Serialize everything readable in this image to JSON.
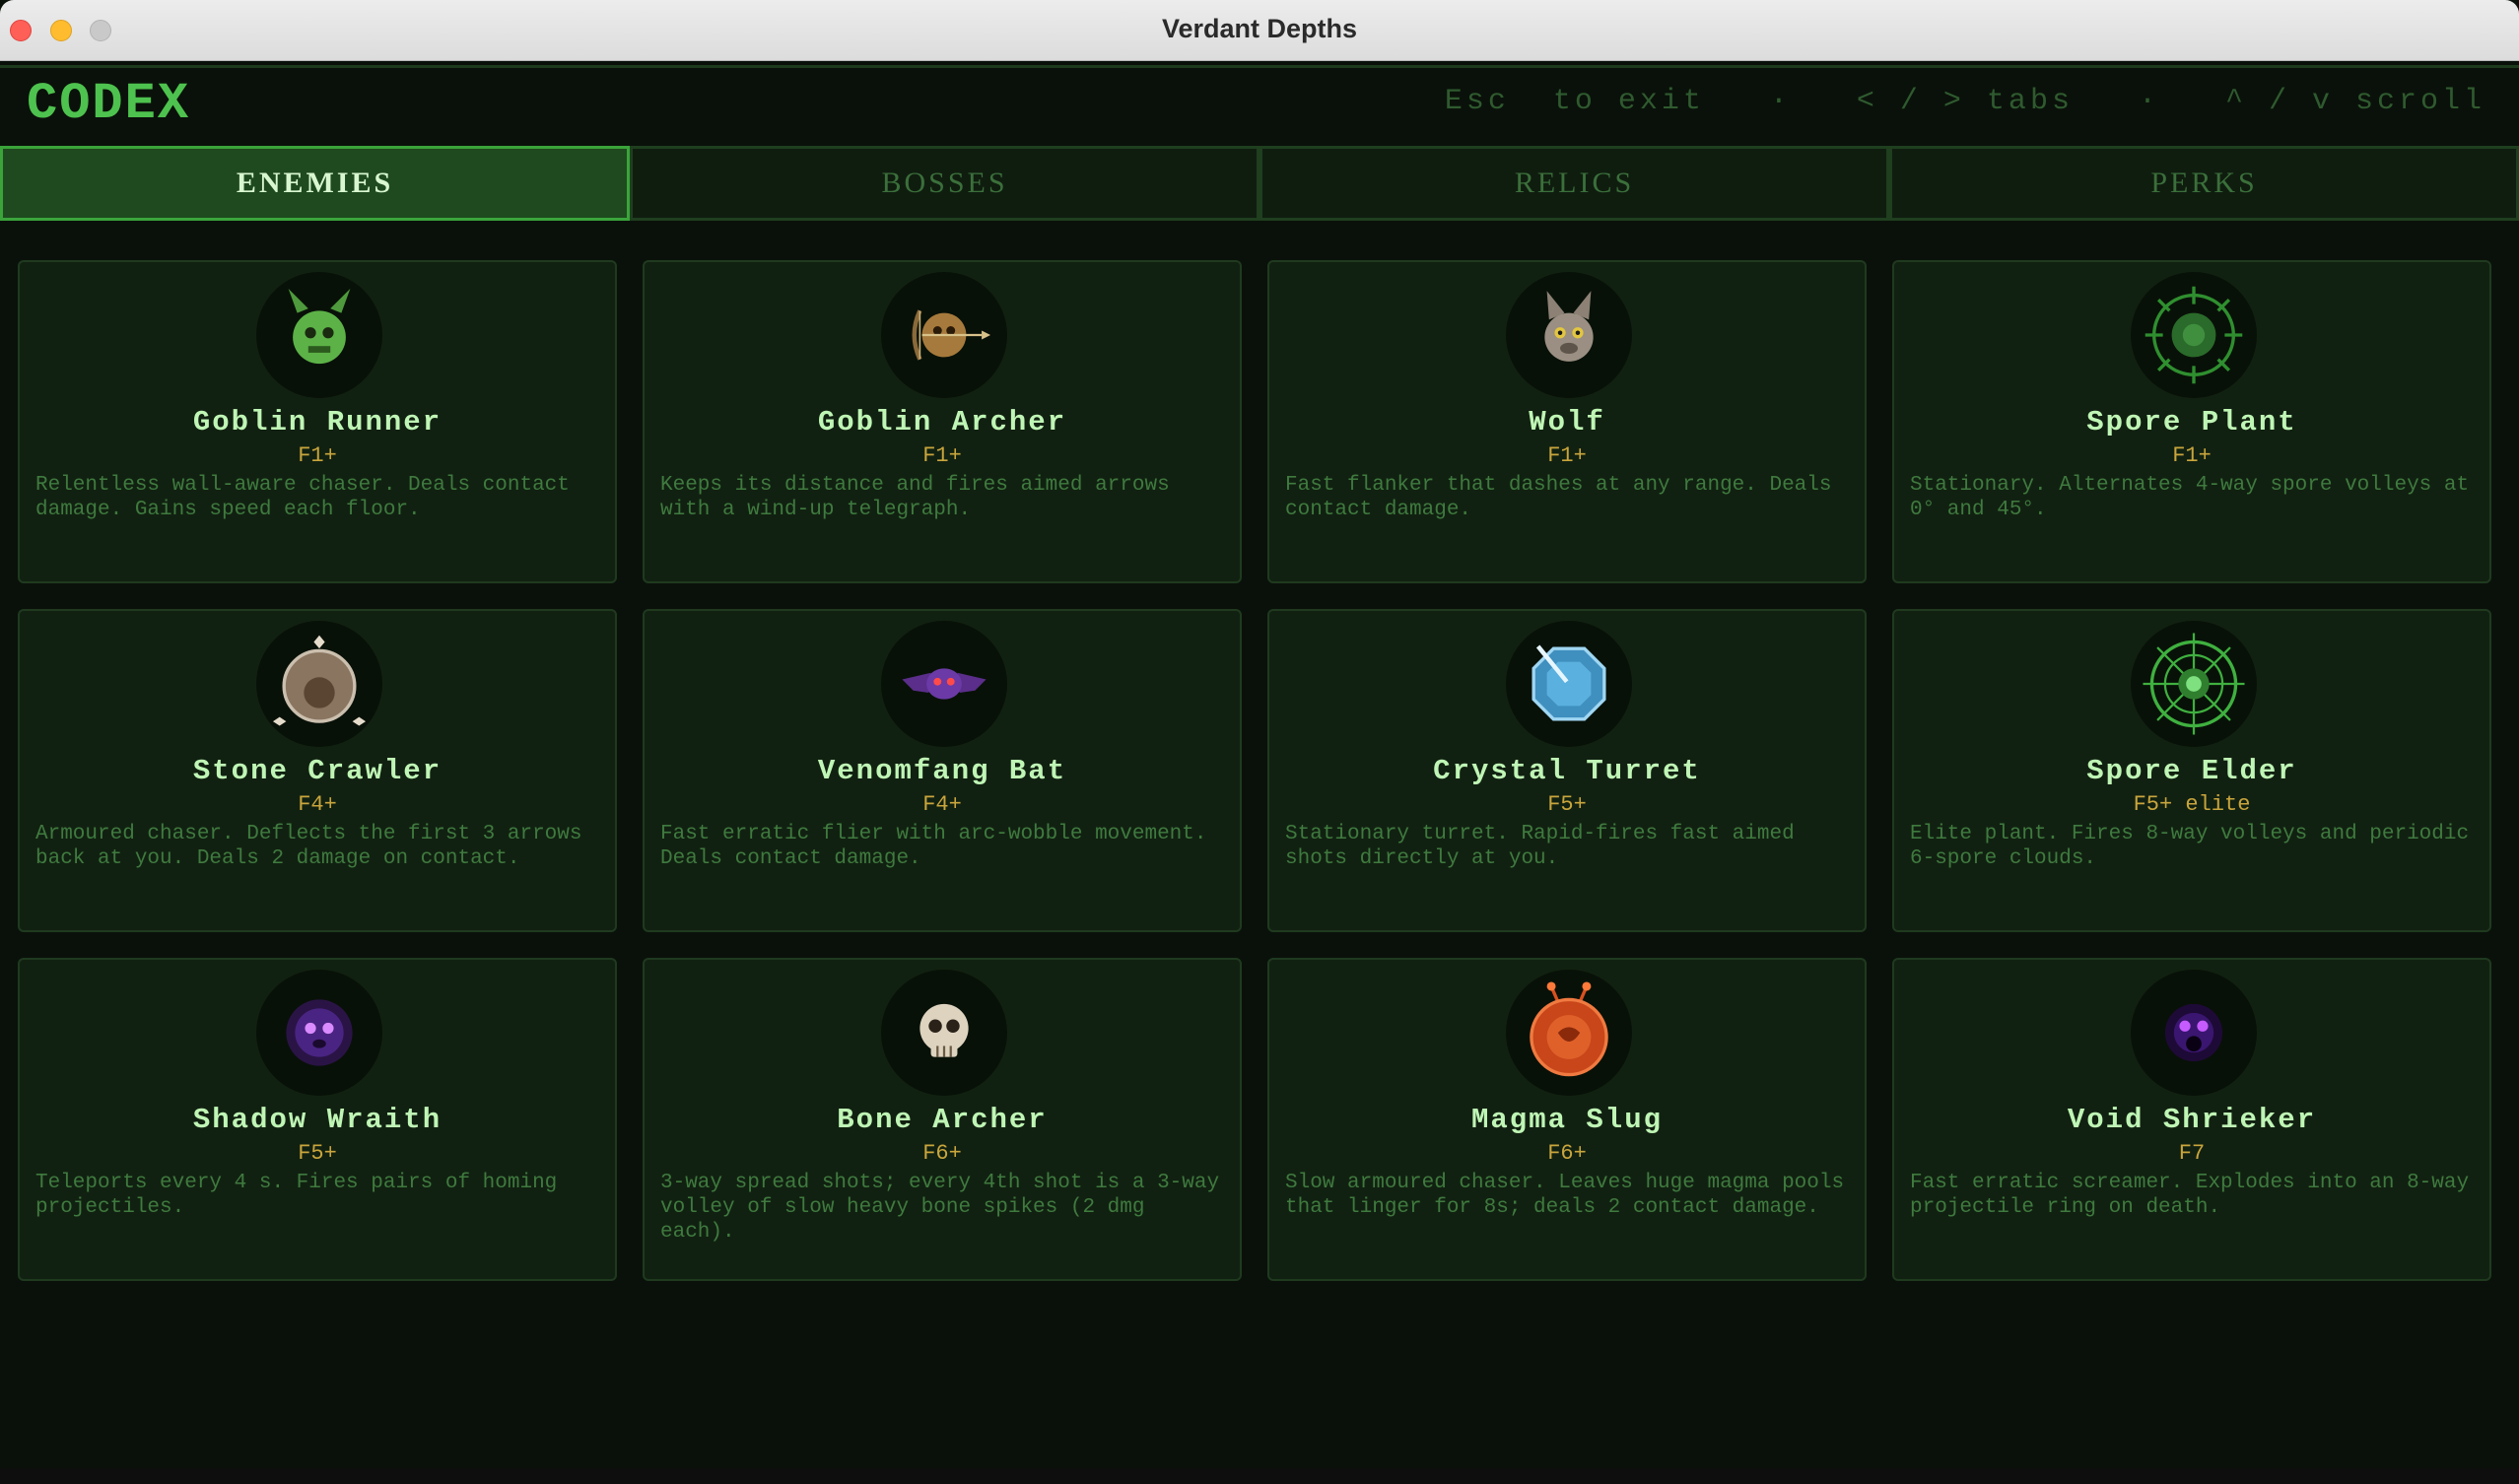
{
  "window": {
    "title": "Verdant Depths"
  },
  "header": {
    "title": "CODEX",
    "hints": "Esc  to exit   ·   < / > tabs   ·   ^ / v scroll"
  },
  "tabs": [
    {
      "label": "ENEMIES",
      "active": true
    },
    {
      "label": "BOSSES",
      "active": false
    },
    {
      "label": "RELICS",
      "active": false
    },
    {
      "label": "PERKS",
      "active": false
    }
  ],
  "enemies": [
    {
      "name": "Goblin Runner",
      "floor": "F1+",
      "desc": "Relentless wall-aware chaser. Deals contact damage. Gains speed each floor.",
      "icon": "goblin-icon"
    },
    {
      "name": "Goblin Archer",
      "floor": "F1+",
      "desc": "Keeps its distance and fires aimed arrows with a wind-up telegraph.",
      "icon": "goblin-archer-icon"
    },
    {
      "name": "Wolf",
      "floor": "F1+",
      "desc": "Fast flanker that dashes at any range. Deals contact damage.",
      "icon": "wolf-icon"
    },
    {
      "name": "Spore Plant",
      "floor": "F1+",
      "desc": "Stationary. Alternates 4-way spore volleys at 0° and 45°.",
      "icon": "spore-plant-icon"
    },
    {
      "name": "Stone Crawler",
      "floor": "F4+",
      "desc": "Armoured chaser. Deflects the first 3 arrows back at you. Deals 2 damage on contact.",
      "icon": "stone-crawler-icon"
    },
    {
      "name": "Venomfang Bat",
      "floor": "F4+",
      "desc": "Fast erratic flier with arc-wobble movement. Deals contact damage.",
      "icon": "bat-icon"
    },
    {
      "name": "Crystal Turret",
      "floor": "F5+",
      "desc": "Stationary turret. Rapid-fires fast aimed shots directly at you.",
      "icon": "crystal-turret-icon"
    },
    {
      "name": "Spore Elder",
      "floor": "F5+ elite",
      "desc": "Elite plant. Fires 8-way volleys and periodic 6-spore clouds.",
      "icon": "spore-elder-icon"
    },
    {
      "name": "Shadow Wraith",
      "floor": "F5+",
      "desc": "Teleports every 4 s. Fires pairs of homing projectiles.",
      "icon": "wraith-icon"
    },
    {
      "name": "Bone Archer",
      "floor": "F6+",
      "desc": "3-way spread shots; every 4th shot is a 3-way volley of slow heavy bone spikes (2 dmg each).",
      "icon": "skull-icon"
    },
    {
      "name": "Magma Slug",
      "floor": "F6+",
      "desc": "Slow armoured chaser. Leaves huge magma pools that linger for 8s; deals 2 contact damage.",
      "icon": "magma-slug-icon"
    },
    {
      "name": "Void Shrieker",
      "floor": "F7",
      "desc": "Fast erratic screamer. Explodes into an 8-way projectile ring on death.",
      "icon": "void-shrieker-icon"
    }
  ],
  "colors": {
    "accent": "#4ec24e",
    "tab_active_bg": "#1f4a1f",
    "card_bg": "#112111",
    "floor_text": "#c9a53c"
  }
}
